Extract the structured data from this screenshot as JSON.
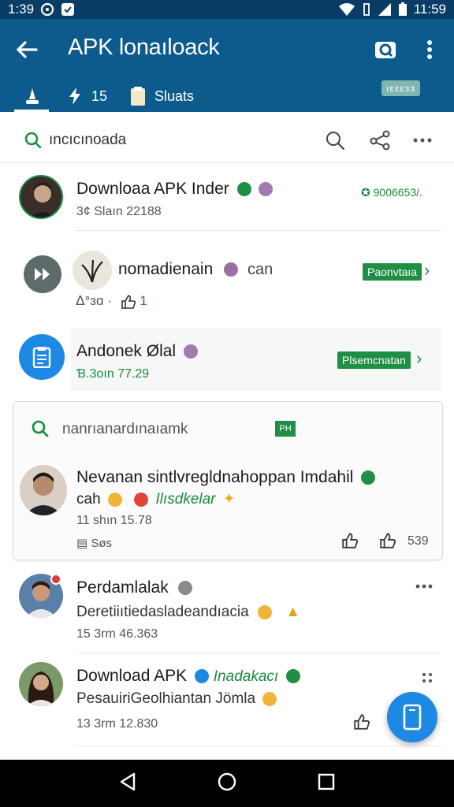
{
  "status_bar": {
    "time_left": "1:39",
    "time_right": "11:59"
  },
  "app_bar": {
    "title": "APK lonaıloack"
  },
  "tabs": [
    {
      "label": ""
    },
    {
      "label": "15"
    },
    {
      "label": "Sluats"
    }
  ],
  "tab_chip": "ıɛɛɛɜɜ",
  "search": {
    "text": "ıncıcınoada"
  },
  "items": [
    {
      "title": "Downloaa APK Inder",
      "sub": "3¢ Slaın  22188",
      "right": "✪ 9006653/."
    },
    {
      "title": "nomadienain",
      "suffix": "can",
      "sub_left": "ᐃᐤɜɑ ·",
      "sub_count": "1",
      "pill": "Paonvtaıa"
    },
    {
      "title": "Andonek Ølal",
      "sub": "Ɓ.3oın 77.29",
      "pill": "Plsemcnatan"
    }
  ],
  "card": {
    "search_text": "nanrıanardınaıamk",
    "chip": "PH",
    "title": "Nevanan sintlvregldnahoppan Imdahil",
    "line2_left": "cah",
    "line2_green": "Ilısdkelar",
    "time": "11 shın  15.78",
    "meta": "Søs",
    "count": "539"
  },
  "items2": [
    {
      "title": "Perdamlalak",
      "sub": "Deretiiıtiedasladeandıacia",
      "time": "15 3rm  46.363"
    },
    {
      "title": "Download APK",
      "green": "Inadakacı",
      "sub": "PesauiriGeolhiantan Jömla",
      "time": "13 3rm  12.830"
    }
  ],
  "colors": {
    "status_bar": "#0a3d66",
    "app_bar": "#0c5b8c",
    "accent_green": "#1f8f45",
    "fab": "#1e88e5"
  }
}
